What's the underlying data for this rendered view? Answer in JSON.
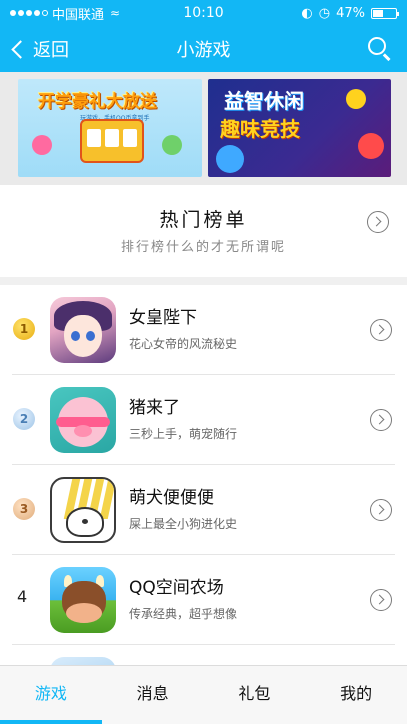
{
  "status_bar": {
    "carrier": "中国联通",
    "time": "10:10",
    "battery_percent": "47%",
    "battery_level": 0.47
  },
  "nav": {
    "back_label": "返回",
    "title": "小游戏"
  },
  "banners": {
    "left": {
      "title": "开学豪礼大放送",
      "subtitle": "玩游戏，手机QQ币拿到手"
    },
    "right": {
      "line1": "益智休闲",
      "line2": "趣味竞技"
    }
  },
  "hot_list": {
    "title": "热门榜单",
    "subtitle": "排行榜什么的才无所谓呢"
  },
  "games": [
    {
      "rank": "1",
      "name": "女皇陛下",
      "desc": "花心女帝的风流秘史"
    },
    {
      "rank": "2",
      "name": "猪来了",
      "desc": "三秒上手，萌宠随行"
    },
    {
      "rank": "3",
      "name": "萌犬便便便",
      "desc": "屎上最全小狗进化史"
    },
    {
      "rank": "4",
      "name": "QQ空间农场",
      "desc": "传承经典，超乎想像"
    }
  ],
  "tabs": [
    {
      "label": "游戏",
      "active": true
    },
    {
      "label": "消息",
      "active": false
    },
    {
      "label": "礼包",
      "active": false
    },
    {
      "label": "我的",
      "active": false
    }
  ],
  "colors": {
    "accent": "#12b7f5",
    "divider": "#e5e5e5",
    "section_bg": "#f0f0f0"
  }
}
